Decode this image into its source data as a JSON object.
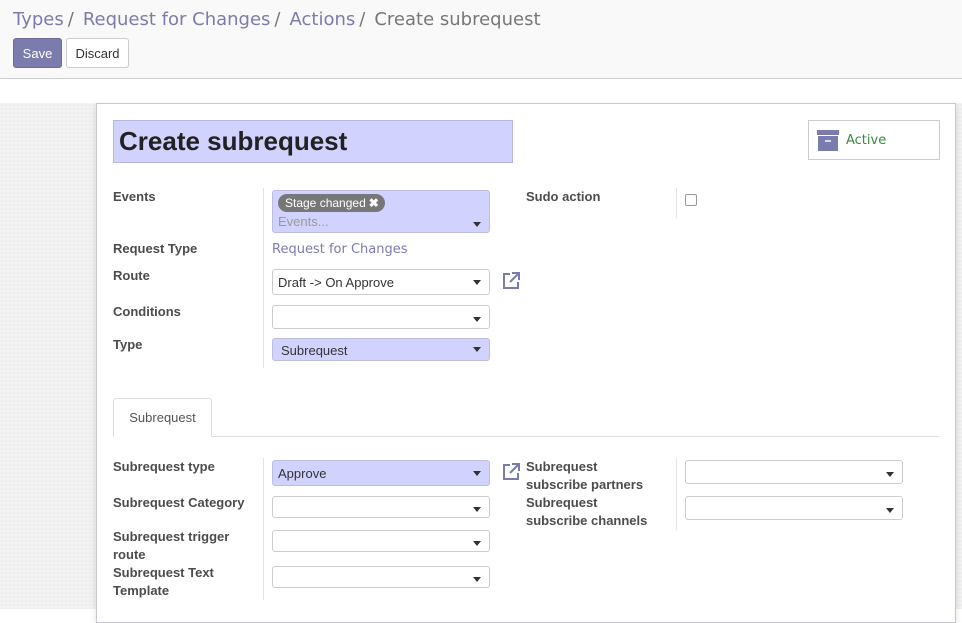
{
  "breadcrumb": {
    "items": [
      "Types",
      "Request for Changes",
      "Actions"
    ],
    "separator": "/",
    "current": "Create subrequest"
  },
  "buttons": {
    "save": "Save",
    "discard": "Discard"
  },
  "record": {
    "name": "Create subrequest",
    "status": "Active"
  },
  "fields": {
    "events": {
      "label": "Events",
      "tag": "Stage changed",
      "tag_remove": "✖",
      "placeholder": "Events..."
    },
    "request_type": {
      "label": "Request Type",
      "value": "Request for Changes"
    },
    "route": {
      "label": "Route",
      "value": "Draft -> On Approve"
    },
    "conditions": {
      "label": "Conditions",
      "value": ""
    },
    "type": {
      "label": "Type",
      "value": "Subrequest"
    },
    "sudo_action": {
      "label": "Sudo action",
      "checked": false
    }
  },
  "tabs": [
    {
      "label": "Subrequest"
    }
  ],
  "subrequest": {
    "type": {
      "label": "Subrequest type",
      "value": "Approve"
    },
    "category": {
      "label": "Subrequest Category",
      "value": ""
    },
    "trigger_route": {
      "label_1": "Subrequest trigger",
      "label_2": "route",
      "value": ""
    },
    "text_template": {
      "label_1": "Subrequest Text",
      "label_2": "Template",
      "value": ""
    },
    "subscribe_partners": {
      "label_1": "Subrequest",
      "label_2": "subscribe partners",
      "value": ""
    },
    "subscribe_channels": {
      "label_1": "Subrequest",
      "label_2": "subscribe channels",
      "value": ""
    }
  },
  "icons": {
    "archive": "archive-box-icon",
    "external": "external-link-icon",
    "caret": "caret-down-icon"
  },
  "colors": {
    "accent": "#7c7bad",
    "required_bg": "#d2d2ff",
    "active_green": "#3c8a3c",
    "tag_bg": "#777777"
  }
}
